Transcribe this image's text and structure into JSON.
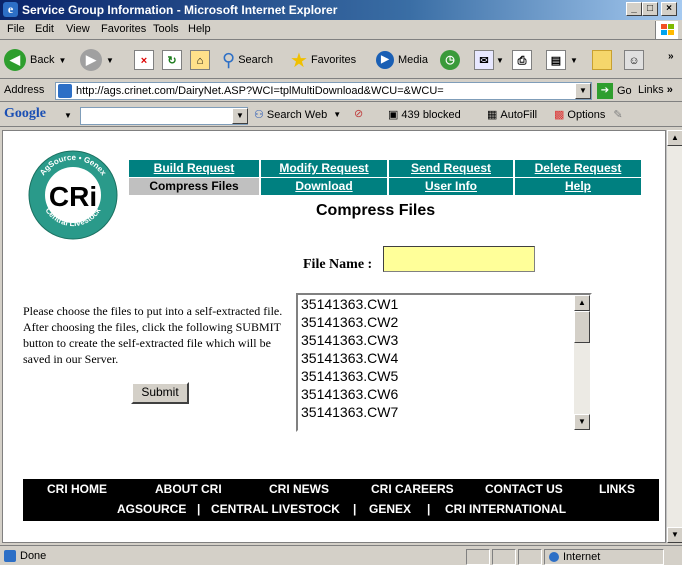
{
  "window": {
    "title": "Service Group Information - Microsoft Internet Explorer"
  },
  "menu": [
    "File",
    "Edit",
    "View",
    "Favorites",
    "Tools",
    "Help"
  ],
  "toolbar": {
    "back": "Back",
    "search": "Search",
    "favorites": "Favorites",
    "media": "Media"
  },
  "address": {
    "label": "Address",
    "url": "http://ags.crinet.com/DairyNet.ASP?WCI=tplMultiDownload&WCU=&WCU=",
    "go": "Go",
    "links": "Links"
  },
  "google": {
    "logo": "Google",
    "search_web": "Search Web",
    "blocked": "439 blocked",
    "autofill": "AutoFill",
    "options": "Options"
  },
  "logo": {
    "top_text": "AgSource • Genex",
    "center": "CRi",
    "bottom_text": "Central Livestock"
  },
  "nav": {
    "row1": [
      "Build Request",
      "Modify Request",
      "Send Request",
      "Delete Request"
    ],
    "row2": [
      "Compress Files",
      "Download",
      "User Info",
      "Help"
    ],
    "current": "Compress Files"
  },
  "page": {
    "title": "Compress Files",
    "file_name_label": "File Name :",
    "file_name_value": "",
    "instructions": "Please choose the files to put into a self-extracted file. After choosing the files, click the following SUBMIT button to create the self-extracted file which will be saved in our Server.",
    "submit_label": "Submit",
    "files": [
      "35141363.CW1",
      "35141363.CW2",
      "35141363.CW3",
      "35141363.CW4",
      "35141363.CW5",
      "35141363.CW6",
      "35141363.CW7"
    ]
  },
  "footer": {
    "row1": [
      "CRI HOME",
      "ABOUT CRI",
      "CRI NEWS",
      "CRI CAREERS",
      "CONTACT US",
      "LINKS"
    ],
    "row2": [
      "AGSOURCE",
      "|",
      "CENTRAL LIVESTOCK",
      "|",
      "GENEX",
      "|",
      "CRI INTERNATIONAL"
    ]
  },
  "status": {
    "text": "Done",
    "zone": "Internet"
  },
  "colors": {
    "nav_teal": "#008080",
    "nav_current": "#c0c0c0",
    "input_yellow": "#ffff99",
    "footer_black": "#000000"
  }
}
